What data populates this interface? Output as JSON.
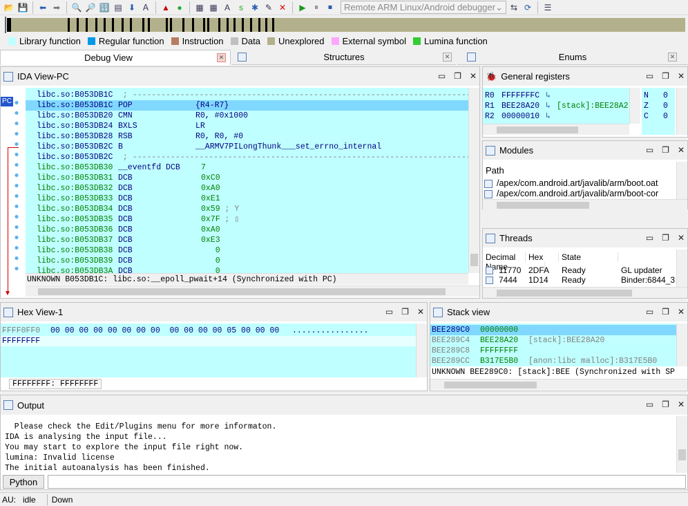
{
  "toolbar": {
    "debugger_select": "Remote ARM Linux/Android debugger"
  },
  "legend": [
    {
      "label": "Library function",
      "color": "#c0ffff"
    },
    {
      "label": "Regular function",
      "color": "#0099e6"
    },
    {
      "label": "Instruction",
      "color": "#b57d5f"
    },
    {
      "label": "Data",
      "color": "#c0c0c0"
    },
    {
      "label": "Unexplored",
      "color": "#b3b18b"
    },
    {
      "label": "External symbol",
      "color": "#ffa6ff"
    },
    {
      "label": "Lumina function",
      "color": "#33cc33"
    }
  ],
  "tabs": {
    "debug_view": "Debug View",
    "structures": "Structures",
    "enums": "Enums"
  },
  "ida_view": {
    "title": "IDA View-PC",
    "pc_label": "PC",
    "lines": [
      {
        "addr": "libc.so:B053DB1C",
        "text": " ; ---------------------------------------------------------------------------",
        "cls": "cmt"
      },
      {
        "addr": "libc.so:B053DB1C",
        "mnem": "POP",
        "ops": "{R4-R7}",
        "hl": true
      },
      {
        "addr": "libc.so:B053DB20",
        "mnem": "CMN",
        "ops": "R0, #0x1000"
      },
      {
        "addr": "libc.so:B053DB24",
        "mnem": "BXLS",
        "ops": "LR"
      },
      {
        "addr": "libc.so:B053DB28",
        "mnem": "RSB",
        "ops": "R0, R0, #0"
      },
      {
        "addr": "libc.so:B053DB2C",
        "mnem": "B",
        "ops": "__ARMV7PILongThunk___set_errno_internal"
      },
      {
        "addr": "libc.so:B053DB2C",
        "text": " ; ---------------------------------------------------------------------------",
        "cls": "cmt"
      },
      {
        "addr": "libc.so:B053DB30",
        "mnem": "__eventfd DCB",
        "ops": "7",
        "green": true
      },
      {
        "addr": "libc.so:B053DB31",
        "mnem": "DCB",
        "ops": "0xC0",
        "green": true
      },
      {
        "addr": "libc.so:B053DB32",
        "mnem": "DCB",
        "ops": "0xA0",
        "green": true
      },
      {
        "addr": "libc.so:B053DB33",
        "mnem": "DCB",
        "ops": "0xE1",
        "green": true
      },
      {
        "addr": "libc.so:B053DB34",
        "mnem": "DCB",
        "ops": "0x59",
        "cmt": " ; Y",
        "green": true
      },
      {
        "addr": "libc.so:B053DB35",
        "mnem": "DCB",
        "ops": "0x7F",
        "cmt": " ; ▯",
        "green": true
      },
      {
        "addr": "libc.so:B053DB36",
        "mnem": "DCB",
        "ops": "0xA0",
        "green": true
      },
      {
        "addr": "libc.so:B053DB37",
        "mnem": "DCB",
        "ops": "0xE3",
        "green": true
      },
      {
        "addr": "libc.so:B053DB38",
        "mnem": "DCB",
        "ops": "   0",
        "green": true
      },
      {
        "addr": "libc.so:B053DB39",
        "mnem": "DCB",
        "ops": "   0",
        "green": true
      },
      {
        "addr": "libc.so:B053DB3A",
        "mnem": "DCB",
        "ops": "   0",
        "green": true
      }
    ],
    "status": "UNKNOWN B053DB1C: libc.so:__epoll_pwait+14 (Synchronized with PC)"
  },
  "registers": {
    "title": "General registers",
    "rows": [
      {
        "name": "R0",
        "value": "FFFFFFFC",
        "note": ""
      },
      {
        "name": "R1",
        "value": "BEE28A20",
        "note": "[stack]:BEE28A2"
      },
      {
        "name": "R2",
        "value": "00000010",
        "note": ""
      }
    ],
    "flags": [
      {
        "name": "N",
        "value": "0"
      },
      {
        "name": "Z",
        "value": "0"
      },
      {
        "name": "C",
        "value": "0"
      }
    ]
  },
  "modules": {
    "title": "Modules",
    "header": "Path",
    "rows": [
      "/apex/com.android.art/javalib/arm/boot.oat",
      "/apex/com.android.art/javalib/arm/boot-cor"
    ]
  },
  "threads": {
    "title": "Threads",
    "columns": [
      "Decimal",
      "Hex",
      "State",
      "Name"
    ],
    "rows": [
      [
        "11770",
        "2DFA",
        "Ready",
        "GL updater"
      ],
      [
        "7444",
        "1D14",
        "Ready",
        "Binder:6844_3"
      ]
    ]
  },
  "hex_view": {
    "title": "Hex View-1",
    "rows": [
      {
        "addr": "FFFF0FF0",
        "bytes": "00 00 00 00 00 00 00 00  00 00 00 00 05 00 00 00",
        "ascii": "................"
      },
      {
        "addr": "FFFFFFFF",
        "bytes": "",
        "ascii": ""
      }
    ],
    "status": "FFFFFFFF: FFFFFFFF"
  },
  "stack_view": {
    "title": "Stack view",
    "rows": [
      {
        "addr": "BEE289C0",
        "value": "00000000",
        "note": "",
        "hl": true
      },
      {
        "addr": "BEE289C4",
        "value": "BEE28A20",
        "note": "[stack]:BEE28A20"
      },
      {
        "addr": "BEE289C8",
        "value": "FFFFFFFF",
        "note": ""
      },
      {
        "addr": "BEE289CC",
        "value": "B317E5B0",
        "note": "[anon:libc malloc]:B317E5B0"
      }
    ],
    "status": "UNKNOWN BEE289C0: [stack]:BEE (Synchronized with SP"
  },
  "output": {
    "title": "Output",
    "lines": [
      "  Please check the Edit/Plugins menu for more informaton.",
      "IDA is analysing the input file...",
      "You may start to explore the input file right now.",
      "lumina: Invalid license",
      "The initial autoanalysis has been finished."
    ],
    "python_button": "Python"
  },
  "statusbar": {
    "au_label": "AU:",
    "au_state": "idle",
    "direction": "Down"
  }
}
